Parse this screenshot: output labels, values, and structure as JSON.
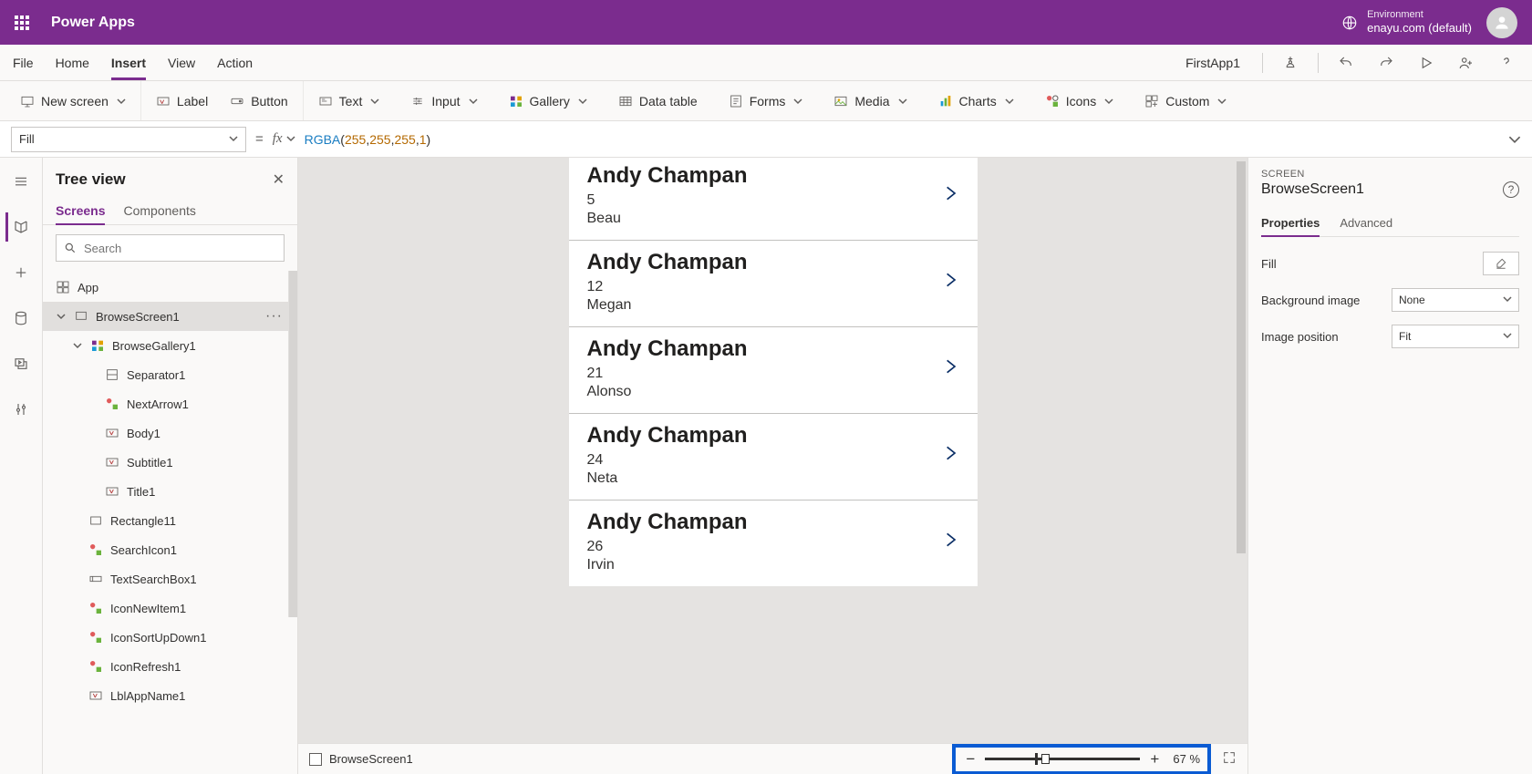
{
  "header": {
    "title": "Power Apps",
    "env_label": "Environment",
    "env_value": "enayu.com (default)"
  },
  "menu": {
    "items": [
      "File",
      "Home",
      "Insert",
      "View",
      "Action"
    ],
    "active": "Insert",
    "app_name": "FirstApp1"
  },
  "ribbon": {
    "new_screen": "New screen",
    "label": "Label",
    "button": "Button",
    "text": "Text",
    "input": "Input",
    "gallery": "Gallery",
    "datatable": "Data table",
    "forms": "Forms",
    "media": "Media",
    "charts": "Charts",
    "icons": "Icons",
    "custom": "Custom"
  },
  "formula": {
    "property": "Fill",
    "fn": "RGBA",
    "args": [
      "255",
      "255",
      "255",
      "1"
    ]
  },
  "tree": {
    "title": "Tree view",
    "tabs": [
      "Screens",
      "Components"
    ],
    "search_placeholder": "Search",
    "app_label": "App",
    "selected": "BrowseScreen1",
    "nodes": {
      "browsescreen": "BrowseScreen1",
      "gallery": "BrowseGallery1",
      "sep": "Separator1",
      "next": "NextArrow1",
      "body": "Body1",
      "subtitle": "Subtitle1",
      "title1": "Title1",
      "rect": "Rectangle11",
      "searchicon": "SearchIcon1",
      "searchbox": "TextSearchBox1",
      "newitem": "IconNewItem1",
      "sort": "IconSortUpDown1",
      "refresh": "IconRefresh1",
      "appname": "LblAppName1"
    }
  },
  "gallery_items": [
    {
      "title": "Andy Champan",
      "sub1": "5",
      "sub2": "Beau"
    },
    {
      "title": "Andy Champan",
      "sub1": "12",
      "sub2": "Megan"
    },
    {
      "title": "Andy Champan",
      "sub1": "21",
      "sub2": "Alonso"
    },
    {
      "title": "Andy Champan",
      "sub1": "24",
      "sub2": "Neta"
    },
    {
      "title": "Andy Champan",
      "sub1": "26",
      "sub2": "Irvin"
    }
  ],
  "canvas_footer": {
    "screen_name": "BrowseScreen1",
    "zoom_percent": "67",
    "percent_sign": "%"
  },
  "props": {
    "type": "SCREEN",
    "name": "BrowseScreen1",
    "tabs": [
      "Properties",
      "Advanced"
    ],
    "fill_label": "Fill",
    "bg_label": "Background image",
    "bg_value": "None",
    "pos_label": "Image position",
    "pos_value": "Fit"
  }
}
